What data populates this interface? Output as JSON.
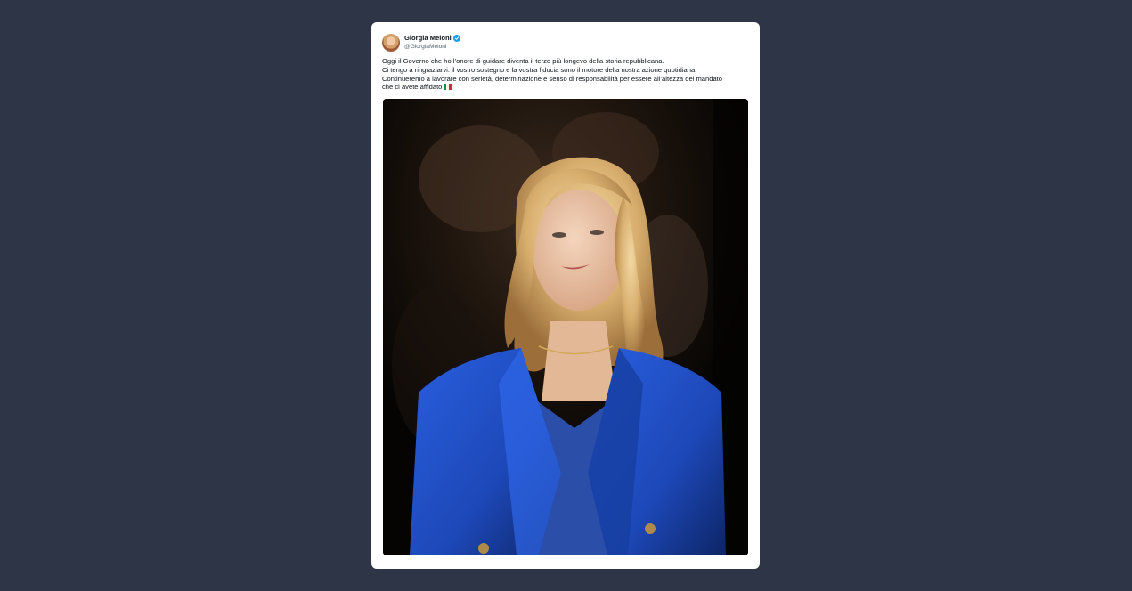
{
  "tweet": {
    "author": {
      "display_name": "Giorgia Meloni",
      "handle": "@GiorgiaMeloni",
      "verified": true,
      "avatar_icon": "profile-avatar"
    },
    "text_lines": [
      "Oggi il Governo che ho l’onore di guidare diventa il terzo più longevo della storia repubblicana.",
      "Ci tengo a ringraziarvi: il vostro sostegno e la vostra fiducia sono il motore della nostra azione quotidiana.",
      "Continueremo a lavorare con serietà, determinazione e senso di responsabilità per essere all’altezza del mandato",
      "che ci avete affidato"
    ],
    "flag_icon": "italy-flag-icon",
    "flag_colors": [
      "#009246",
      "#ffffff",
      "#ce2b37"
    ],
    "media": {
      "type": "photo",
      "icon": "portrait-photo"
    }
  },
  "colors": {
    "background": "#2e3546",
    "card": "#ffffff",
    "verified_badge": "#1d9bf0",
    "text": "#0f1419",
    "handle": "#536471",
    "jacket": "#1f4fc4"
  }
}
